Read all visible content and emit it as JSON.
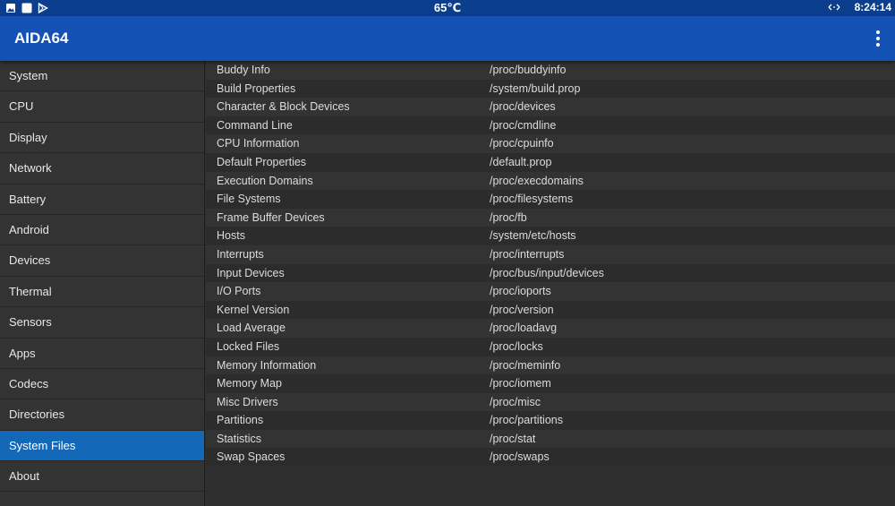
{
  "statusbar": {
    "temperature": "65℃",
    "time": "8:24:14"
  },
  "appbar": {
    "title": "AIDA64"
  },
  "sidebar": {
    "items": [
      {
        "label": "System"
      },
      {
        "label": "CPU"
      },
      {
        "label": "Display"
      },
      {
        "label": "Network"
      },
      {
        "label": "Battery"
      },
      {
        "label": "Android"
      },
      {
        "label": "Devices"
      },
      {
        "label": "Thermal"
      },
      {
        "label": "Sensors"
      },
      {
        "label": "Apps"
      },
      {
        "label": "Codecs"
      },
      {
        "label": "Directories"
      },
      {
        "label": "System Files"
      },
      {
        "label": "About"
      }
    ],
    "selected": "System Files"
  },
  "files": [
    {
      "name": "Buddy Info",
      "path": "/proc/buddyinfo"
    },
    {
      "name": "Build Properties",
      "path": "/system/build.prop"
    },
    {
      "name": "Character & Block Devices",
      "path": "/proc/devices"
    },
    {
      "name": "Command Line",
      "path": "/proc/cmdline"
    },
    {
      "name": "CPU Information",
      "path": "/proc/cpuinfo"
    },
    {
      "name": "Default Properties",
      "path": "/default.prop"
    },
    {
      "name": "Execution Domains",
      "path": "/proc/execdomains"
    },
    {
      "name": "File Systems",
      "path": "/proc/filesystems"
    },
    {
      "name": "Frame Buffer Devices",
      "path": "/proc/fb"
    },
    {
      "name": "Hosts",
      "path": "/system/etc/hosts"
    },
    {
      "name": "Interrupts",
      "path": "/proc/interrupts"
    },
    {
      "name": "Input Devices",
      "path": "/proc/bus/input/devices"
    },
    {
      "name": "I/O Ports",
      "path": "/proc/ioports"
    },
    {
      "name": "Kernel Version",
      "path": "/proc/version"
    },
    {
      "name": "Load Average",
      "path": "/proc/loadavg"
    },
    {
      "name": "Locked Files",
      "path": "/proc/locks"
    },
    {
      "name": "Memory Information",
      "path": "/proc/meminfo"
    },
    {
      "name": "Memory Map",
      "path": "/proc/iomem"
    },
    {
      "name": "Misc Drivers",
      "path": "/proc/misc"
    },
    {
      "name": "Partitions",
      "path": "/proc/partitions"
    },
    {
      "name": "Statistics",
      "path": "/proc/stat"
    },
    {
      "name": "Swap Spaces",
      "path": "/proc/swaps"
    }
  ],
  "colors": {
    "statusbar": "#0b3e8c",
    "appbar": "#1451b5",
    "selected_item": "#1468b8",
    "background": "#2f2f2f"
  },
  "icons": [
    "image-icon",
    "square-icon",
    "play-store-icon",
    "network-arrows-icon",
    "overflow-menu-icon"
  ]
}
